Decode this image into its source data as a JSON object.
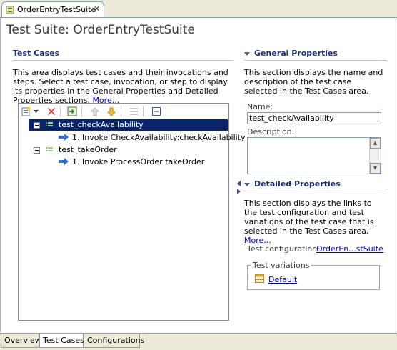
{
  "editor_tab": {
    "title": "OrderEntryTestSuite",
    "close_glyph": "✕"
  },
  "page_title": "Test Suite: OrderEntryTestSuite",
  "test_cases": {
    "title": "Test Cases",
    "description": "This area displays test cases and their invocations and steps. Select a test case, invocation, or step to display its properties in the General Properties and Detailed Properties sections.",
    "more_link": "More...",
    "tree": [
      {
        "label": "test_checkAvailability",
        "selected": true,
        "children": [
          {
            "label": "1. Invoke CheckAvailability:checkAvailability"
          }
        ]
      },
      {
        "label": "test_takeOrder",
        "selected": false,
        "children": [
          {
            "label": "1. Invoke ProcessOrder:takeOrder"
          }
        ]
      }
    ]
  },
  "general_properties": {
    "title": "General Properties",
    "description": "This section displays the name and description of the test case selected in the Test Cases area.",
    "name_label": "Name:",
    "name_value": "test_checkAvailability",
    "description_label": "Description:",
    "description_value": ""
  },
  "detailed_properties": {
    "title": "Detailed Properties",
    "description": "This section displays the links to the test configuration and test variations of the test case that is selected in the Test Cases area.",
    "more_link": "More...",
    "test_configuration_label": "Test configuration:",
    "test_configuration_value": "OrderEn...stSuite",
    "test_variations_label": "Test variations",
    "variation": "Default"
  },
  "bottom_tabs": [
    {
      "label": "Overview",
      "active": false
    },
    {
      "label": "Test Cases",
      "active": true
    },
    {
      "label": "Configurations",
      "active": false
    }
  ],
  "colors": {
    "section_title": "#1c2f74",
    "link": "#0000cc",
    "selection": "#0a246a"
  }
}
